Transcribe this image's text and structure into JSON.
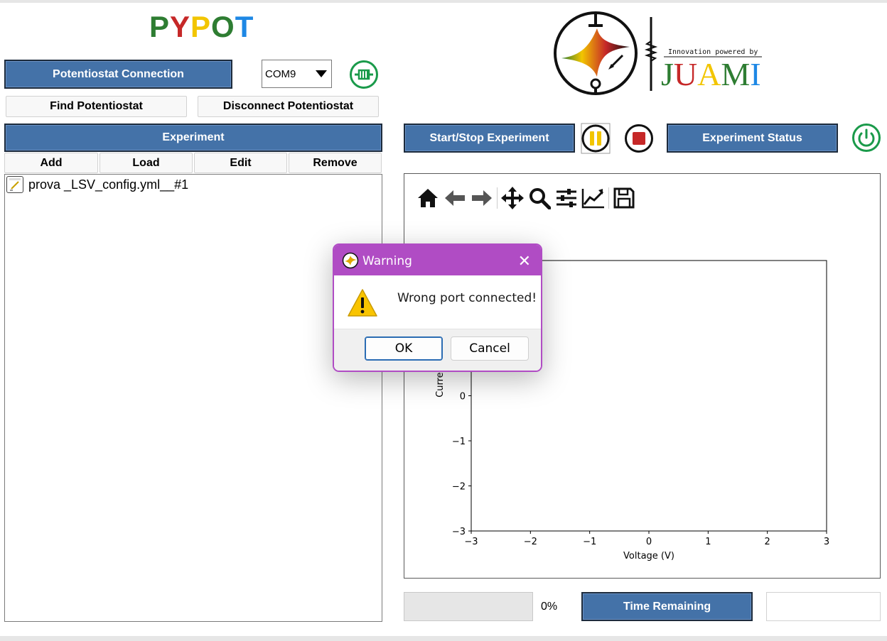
{
  "app": {
    "title_letters": [
      {
        "char": "P",
        "color": "#2e7d32"
      },
      {
        "char": "Y",
        "color": "#c62828"
      },
      {
        "char": "P",
        "color": "#f2c500"
      },
      {
        "char": "O",
        "color": "#2e7d32"
      },
      {
        "char": "T",
        "color": "#1e88e5"
      }
    ]
  },
  "logo": {
    "tagline": "Innovation powered by",
    "brand": "JUAMI"
  },
  "connection": {
    "header_label": "Potentiostat Connection",
    "port_value": "COM9",
    "find_label": "Find Potentiostat",
    "disconnect_label": "Disconnect Potentiostat",
    "status_icon": "connector-icon",
    "status_color": "#1a9a4a"
  },
  "experiment": {
    "header_label": "Experiment",
    "buttons": [
      "Add",
      "Load",
      "Edit",
      "Remove"
    ],
    "items": [
      "prova _LSV_config.yml__#1"
    ]
  },
  "controls": {
    "start_stop_label": "Start/Stop Experiment",
    "status_label": "Experiment Status",
    "pause_icon": "pause-icon",
    "stop_icon": "stop-icon",
    "power_icon": "power-icon",
    "pause_color": "#f2c500",
    "stop_color": "#c62828",
    "power_color": "#1a9a4a"
  },
  "toolbar": {
    "icons": [
      "home-icon",
      "back-arrow-icon",
      "forward-arrow-icon",
      "pan-icon",
      "zoom-icon",
      "subplots-icon",
      "customize-icon",
      "save-icon"
    ]
  },
  "chart_data": {
    "type": "line",
    "xlabel": "Voltage (V)",
    "ylabel": "Current (mA)",
    "xlim": [
      -3,
      3
    ],
    "ylim": [
      -3,
      3
    ],
    "x_ticks": [
      "−3",
      "−2",
      "−1",
      "0",
      "1",
      "2",
      "3"
    ],
    "y_ticks_visible": [
      "0",
      "−1",
      "−2",
      "−3"
    ],
    "series": []
  },
  "footer": {
    "progress_percent": 0,
    "progress_label": "0%",
    "time_label": "Time Remaining",
    "time_value": ""
  },
  "dialog": {
    "title": "Warning",
    "message": "Wrong port connected!",
    "ok_label": "OK",
    "cancel_label": "Cancel",
    "accent": "#b04cc4"
  }
}
